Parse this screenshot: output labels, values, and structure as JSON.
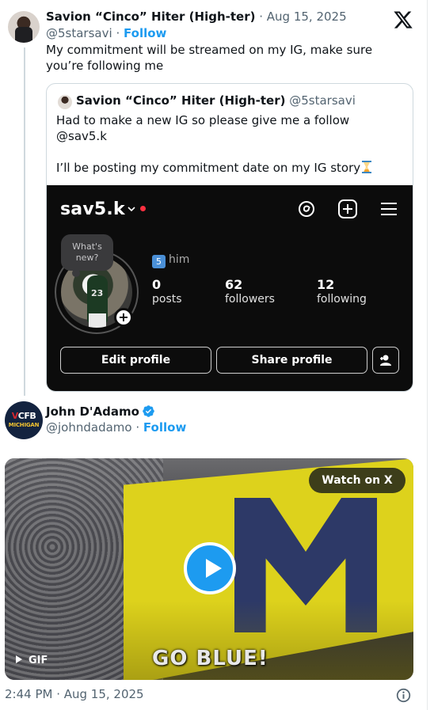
{
  "tweet1": {
    "author_name": "Savion “Cinco” Hiter (High-ter)",
    "date": "· Aug 15, 2025",
    "handle": "@5starsavi",
    "separator": "·",
    "follow_label": "Follow",
    "text": "My commitment will be streamed on my IG, make sure you’re following me"
  },
  "quote": {
    "author_name": "Savion “Cinco” Hiter (High-ter)",
    "handle": "@5starsavi",
    "lines": [
      "Had to make a new IG so please give me a follow",
      "@sav5.k",
      "",
      "I’ll be posting my commitment date on my IG story"
    ],
    "instagram": {
      "username": "sav5.k",
      "bubble": "What's new?",
      "pronoun_badge": "5",
      "pronoun": "him",
      "stats": [
        {
          "value": "0",
          "label": "posts"
        },
        {
          "value": "62",
          "label": "followers"
        },
        {
          "value": "12",
          "label": "following"
        }
      ],
      "edit_label": "Edit profile",
      "share_label": "Share profile",
      "avatar_number": "23"
    }
  },
  "tweet2": {
    "author_name": "John D'Adamo",
    "handle": "@johndadamo",
    "separator": "·",
    "follow_label": "Follow",
    "avatar_top": "CFB",
    "avatar_v": "V",
    "avatar_bottom": "MICHIGAN",
    "video": {
      "watch_label": "Watch on X",
      "gif_label": "GIF",
      "caption": "GO BLUE!"
    }
  },
  "footer": {
    "timestamp": "2:44 PM · Aug 15, 2025"
  },
  "colors": {
    "accent": "#1d9bf0",
    "muted": "#536471",
    "ig_background": "#0c0c0c"
  }
}
